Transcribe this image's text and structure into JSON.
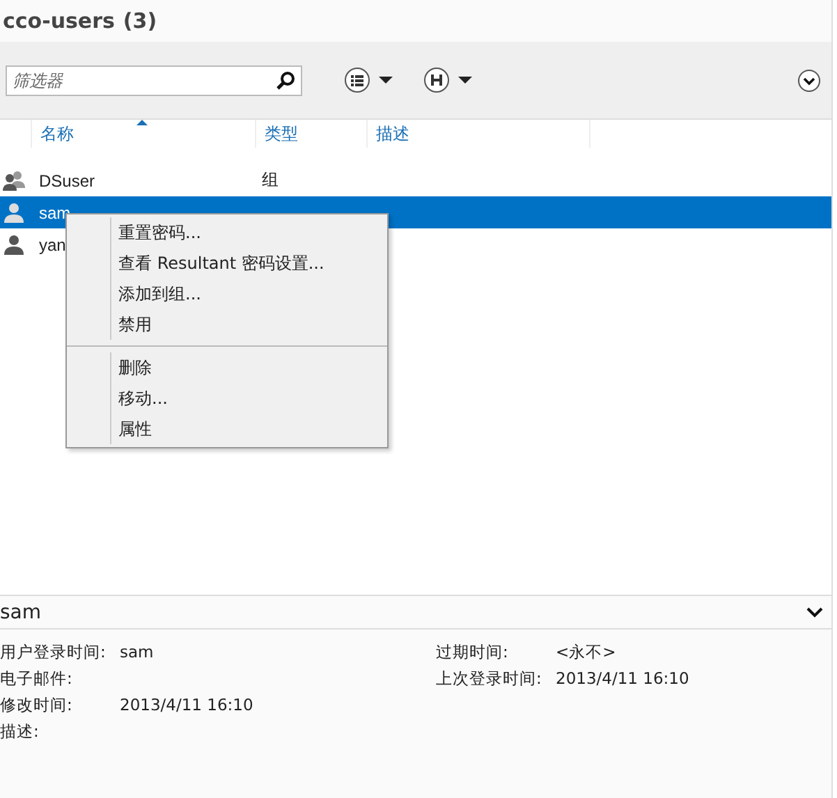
{
  "title": "cco-users",
  "count": "(3)",
  "filter": {
    "placeholder": "筛选器"
  },
  "columns": [
    {
      "label": "名称",
      "sorted": true
    },
    {
      "label": "类型",
      "sorted": false
    },
    {
      "label": "描述",
      "sorted": false
    }
  ],
  "rows": [
    {
      "kind": "group",
      "name": "DSuser",
      "type": "组",
      "selected": false
    },
    {
      "kind": "user",
      "name": "sam",
      "selected": true
    },
    {
      "kind": "user",
      "name": "yan",
      "selected": false
    }
  ],
  "context_menu": [
    {
      "label": "重置密码..."
    },
    {
      "label": "查看 Resultant 密码设置..."
    },
    {
      "label": "添加到组..."
    },
    {
      "label": "禁用"
    },
    {
      "kind": "separator"
    },
    {
      "label": "删除"
    },
    {
      "label": "移动..."
    },
    {
      "label": "属性"
    }
  ],
  "details": {
    "title": "sam",
    "left_fields": [
      {
        "label": "用户登录时间:",
        "value": "sam"
      },
      {
        "label": "电子邮件:"
      },
      {
        "label": "修改时间:",
        "value": "2013/4/11 16:10"
      },
      {
        "label": "描述:"
      }
    ],
    "right_fields": [
      {
        "label": "过期时间:",
        "value": "<永不>"
      },
      {
        "label": "上次登录时间:",
        "value": "2013/4/11 16:10"
      }
    ]
  }
}
